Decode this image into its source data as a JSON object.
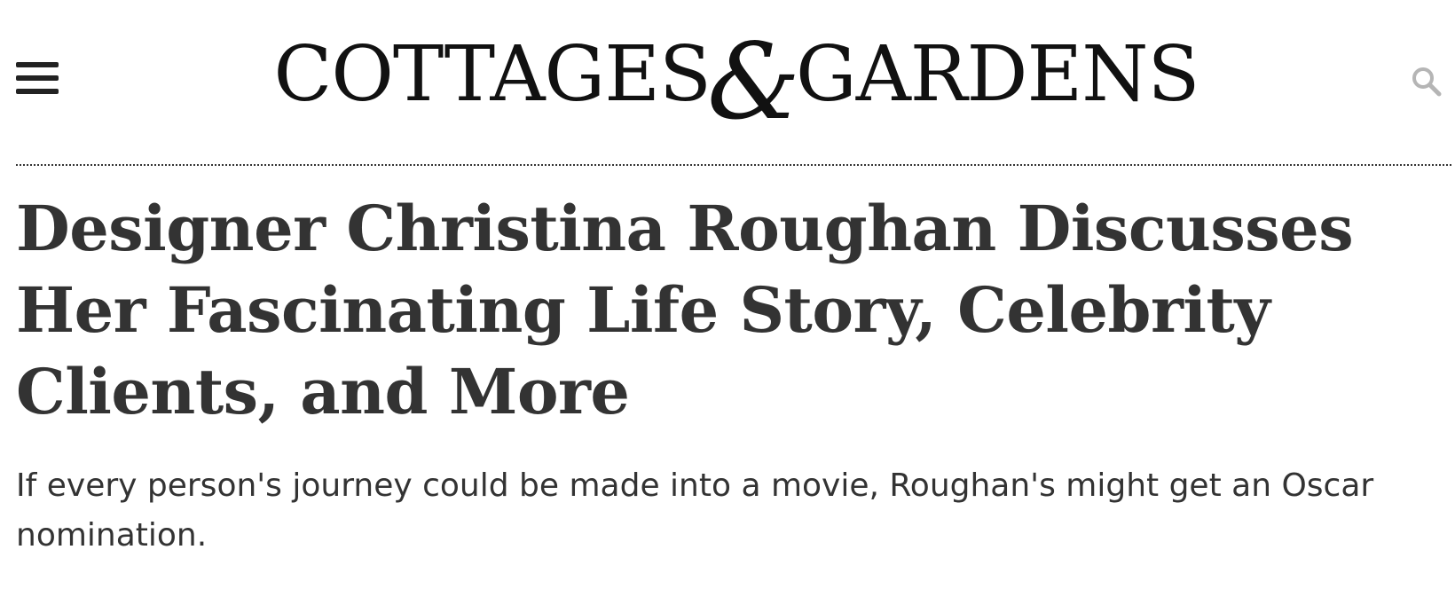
{
  "header": {
    "logo": {
      "left": "COTTAGES",
      "amp": "&",
      "right": "GARDENS"
    },
    "menu_icon": "hamburger-menu-icon",
    "search_icon": "search-icon"
  },
  "article": {
    "headline": "Designer Christina Roughan Discusses Her Fascinating Life Story, Celebrity Clients, and More",
    "dek": "If every person's journey could be made into a movie, Roughan's might get an Oscar nomination."
  },
  "colors": {
    "text": "#333333",
    "logo": "#111111",
    "search_icon": "#b5b5b5",
    "background": "#ffffff"
  }
}
